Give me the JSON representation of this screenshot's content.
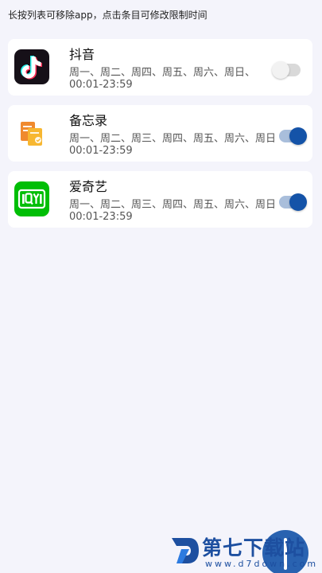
{
  "hint": "长按列表可移除app，点击条目可修改限制时间",
  "apps": [
    {
      "name": "抖音",
      "days": "周一、周二、周四、周五、周六、周日、",
      "time": "00:01-23:59",
      "enabled": false,
      "icon": "douyin-logo-icon"
    },
    {
      "name": "备忘录",
      "days": "周一、周二、周三、周四、周五、周六、周日",
      "time": "00:01-23:59",
      "enabled": true,
      "icon": "notes-icon"
    },
    {
      "name": "爱奇艺",
      "days": "周一、周二、周三、周四、周五、周六、周日",
      "time": "00:01-23:59",
      "enabled": true,
      "icon": "iqiyi-logo-icon"
    }
  ],
  "watermark": {
    "title": "第七下载站",
    "url": "www.d7down.com"
  },
  "colors": {
    "background": "#f4f4fb",
    "toggle_on": "#1453a8",
    "toggle_off": "#d9d9d9",
    "iqiyi_green": "#00be06",
    "douyin_bg": "#161018"
  }
}
